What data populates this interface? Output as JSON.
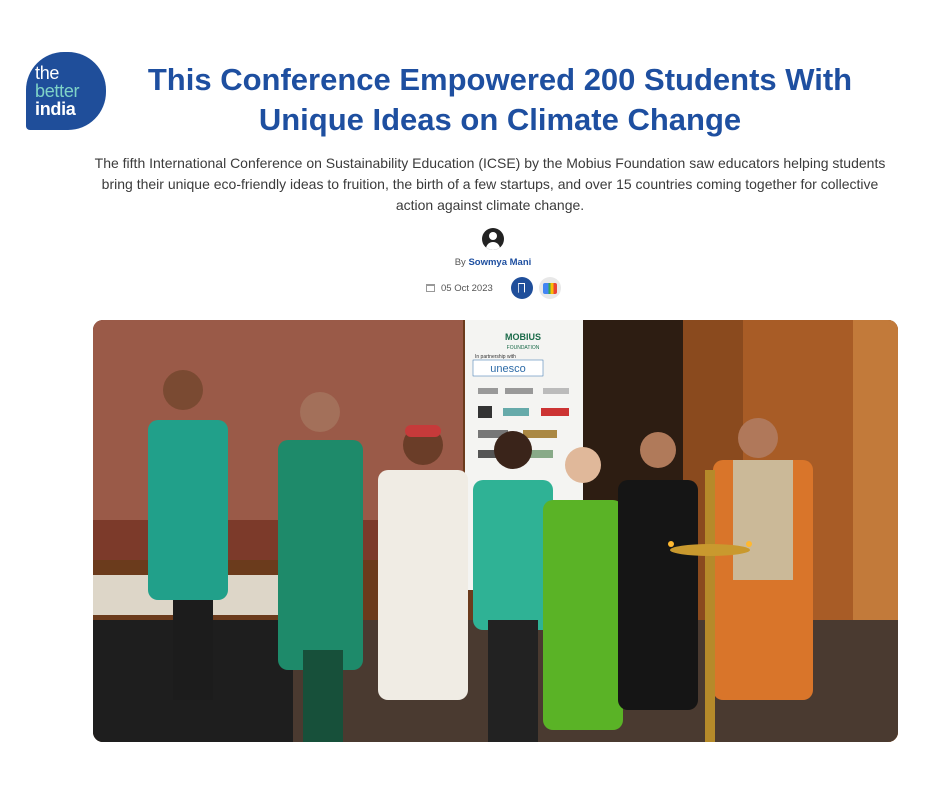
{
  "brand": {
    "logo_line1": "the",
    "logo_line2": "better",
    "logo_line3": "india"
  },
  "article": {
    "title": "This Conference Empowered 200 Students With Unique Ideas on Climate Change",
    "dek": "The fifth International Conference on Sustainability Education (ICSE) by the Mobius Foundation saw educators helping students bring their unique eco-friendly ideas to fruition, the birth of a few startups, and over 15 countries coming together for collective action against climate change.",
    "by_prefix": "By",
    "author": "Sowmya Mani",
    "date": "05 Oct 2023"
  },
  "photo": {
    "banner_logo": "MOBIUS",
    "banner_sub": "FOUNDATION",
    "banner_partner_text": "In partnership with",
    "banner_unesco": "unesco"
  },
  "icons": {
    "author": "user-circle-icon",
    "calendar": "calendar-icon",
    "bookmark": "bookmark-icon",
    "google_news": "google-news-icon"
  },
  "colors": {
    "brand_blue": "#1e4fa0",
    "logo_teal": "#7fd3c7"
  }
}
